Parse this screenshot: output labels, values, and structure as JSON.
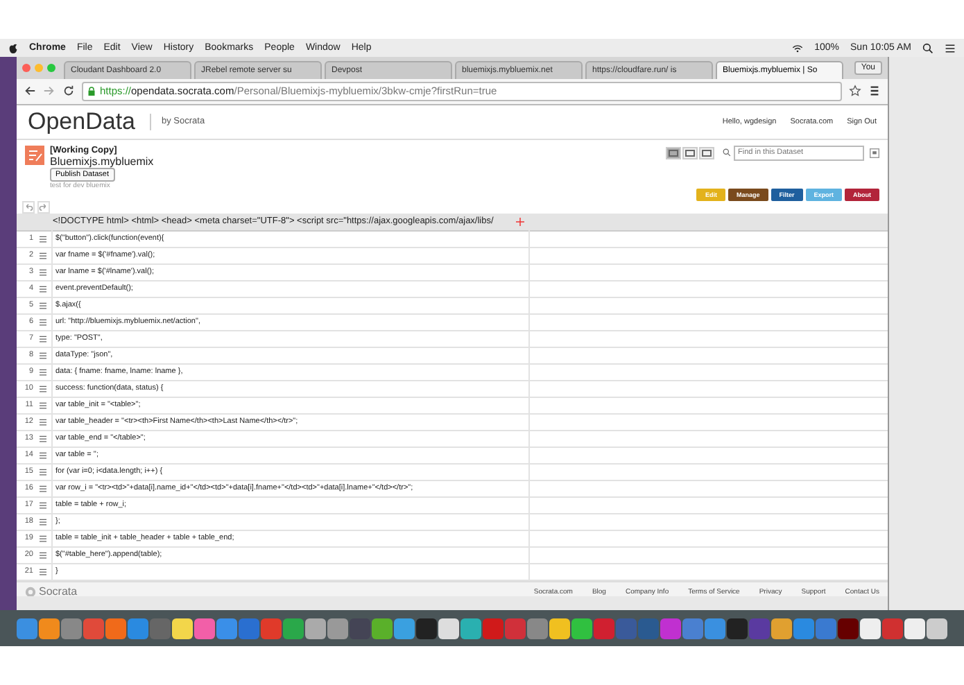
{
  "menubar": {
    "app": "Chrome",
    "menus": [
      "File",
      "Edit",
      "View",
      "History",
      "Bookmarks",
      "People",
      "Window",
      "Help"
    ],
    "battery": "100%",
    "clock": "Sun 10:05 AM"
  },
  "tabs": [
    {
      "title": "Cloudant Dashboard 2.0",
      "selected": false
    },
    {
      "title": "JRebel remote server su",
      "selected": false
    },
    {
      "title": "Devpost",
      "selected": false
    },
    {
      "title": "bluemixjs.mybluemix.net",
      "selected": false
    },
    {
      "title": "https://cloudfare.run/ is",
      "selected": false
    },
    {
      "title": "Bluemixjs.mybluemix | So",
      "selected": true
    }
  ],
  "profile": "You",
  "address": {
    "scheme": "https://",
    "host": "opendata.socrata.com",
    "path": "/Personal/Bluemixjs-mybluemix/3bkw-cmje?firstRun=true"
  },
  "site": {
    "logo": "OpenData",
    "by": "by Socrata",
    "links": [
      "Hello, wgdesign",
      "Socrata.com",
      "Sign Out"
    ]
  },
  "dataset": {
    "badge": "[Working Copy]",
    "title": "Bluemixjs.mybluemix",
    "publish": "Publish Dataset",
    "description": "test for dev bluemix"
  },
  "views": [
    {
      "selected": true
    },
    {
      "selected": false
    },
    {
      "selected": false
    }
  ],
  "search": {
    "placeholder": "Find in this Dataset"
  },
  "actions": [
    {
      "label": "Edit",
      "color": "#e3b21c"
    },
    {
      "label": "Manage",
      "color": "#7a4a1d"
    },
    {
      "label": "Filter",
      "color": "#1f5f9e"
    },
    {
      "label": "Export",
      "color": "#5fb3e0"
    },
    {
      "label": "About",
      "color": "#b2243a"
    }
  ],
  "table": {
    "column_1": "<!DOCTYPE html> <html> <head> <meta charset=\"UTF-8\"> <script src=\"https://ajax.googleapis.com/ajax/libs/",
    "rows": [
      {
        "n": "1",
        "text": "$(\"button\").click(function(event){"
      },
      {
        "n": "2",
        "text": "var fname = $('#fname').val();"
      },
      {
        "n": "3",
        "text": "var lname = $('#lname').val();"
      },
      {
        "n": "4",
        "text": "event.preventDefault();"
      },
      {
        "n": "5",
        "text": "$.ajax({"
      },
      {
        "n": "6",
        "text": "url: \"http://bluemixjs.mybluemix.net/action\","
      },
      {
        "n": "7",
        "text": "type: \"POST\","
      },
      {
        "n": "8",
        "text": "dataType: \"json\","
      },
      {
        "n": "9",
        "text": "data: { fname: fname, lname: lname },"
      },
      {
        "n": "10",
        "text": "success: function(data, status) {"
      },
      {
        "n": "11",
        "text": "var table_init = \"<table>\";"
      },
      {
        "n": "12",
        "text": "var table_header = \"<tr><th>First Name</th><th>Last Name</th></tr>\";"
      },
      {
        "n": "13",
        "text": "var table_end = \"</table>\";"
      },
      {
        "n": "14",
        "text": "var table = '';"
      },
      {
        "n": "15",
        "text": "for (var i=0; i<data.length; i++) {"
      },
      {
        "n": "16",
        "text": "var row_i = \"<tr><td>\"+data[i].name_id+\"</td><td>\"+data[i].fname+\"</td><td>\"+data[i].lname+\"</td></tr>\";"
      },
      {
        "n": "17",
        "text": "table = table + row_i;"
      },
      {
        "n": "18",
        "text": "};"
      },
      {
        "n": "19",
        "text": "table = table_init + table_header + table + table_end;"
      },
      {
        "n": "20",
        "text": "$(\"#table_here\").append(table);"
      },
      {
        "n": "21",
        "text": "}"
      }
    ]
  },
  "footer": {
    "logo": "Socrata",
    "links": [
      "Socrata.com",
      "Blog",
      "Company Info",
      "Terms of Service",
      "Privacy",
      "Support",
      "Contact Us"
    ]
  }
}
